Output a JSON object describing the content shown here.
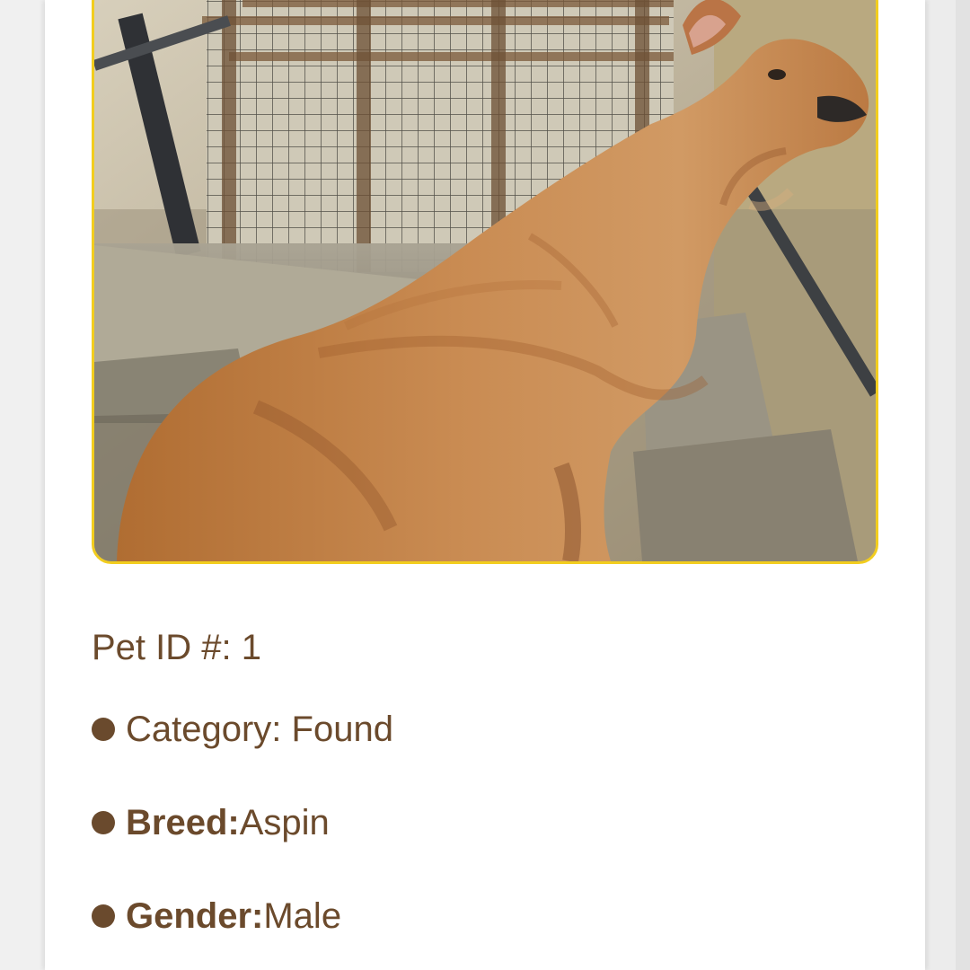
{
  "pet": {
    "image_alt": "Photo of a tan Aspin dog sitting beside a wire-mesh gate",
    "id_line": "Pet ID #: 1",
    "category_line": "Category: Found",
    "breed_label": "Breed:",
    "breed_value": " Aspin",
    "gender_label": "Gender:",
    "gender_value": " Male"
  },
  "colors": {
    "text": "#6b4a2c",
    "bullet": "#6a4a2d",
    "photo_border": "#f2cd1e"
  }
}
